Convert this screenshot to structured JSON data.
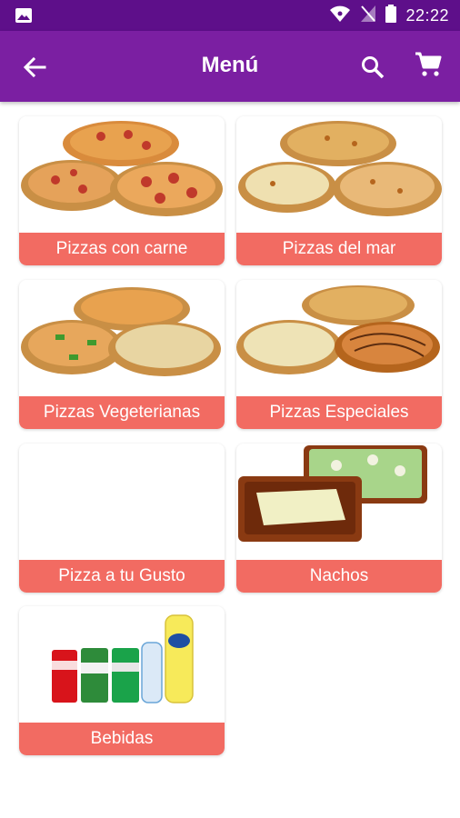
{
  "status_bar": {
    "time": "22:22",
    "icons": [
      "image-icon",
      "wifi-icon",
      "signal-icon",
      "battery-icon"
    ]
  },
  "app_bar": {
    "title": "Menú",
    "back_icon": "arrow-back-icon",
    "search_icon": "search-icon",
    "cart_icon": "cart-icon"
  },
  "colors": {
    "status_bar": "#5e0f8a",
    "app_bar": "#7b1fa2",
    "label_bg": "#f26b62"
  },
  "categories": [
    {
      "label": "Pizzas con carne",
      "image": "pizzas-meat"
    },
    {
      "label": "Pizzas del mar",
      "image": "pizzas-seafood"
    },
    {
      "label": "Pizzas Vegeterianas",
      "image": "pizzas-vegetarian"
    },
    {
      "label": "Pizzas Especiales",
      "image": "pizzas-special"
    },
    {
      "label": "Pizza a tu Gusto",
      "image": ""
    },
    {
      "label": "Nachos",
      "image": "nachos"
    },
    {
      "label": "Bebidas",
      "image": "drinks"
    }
  ]
}
